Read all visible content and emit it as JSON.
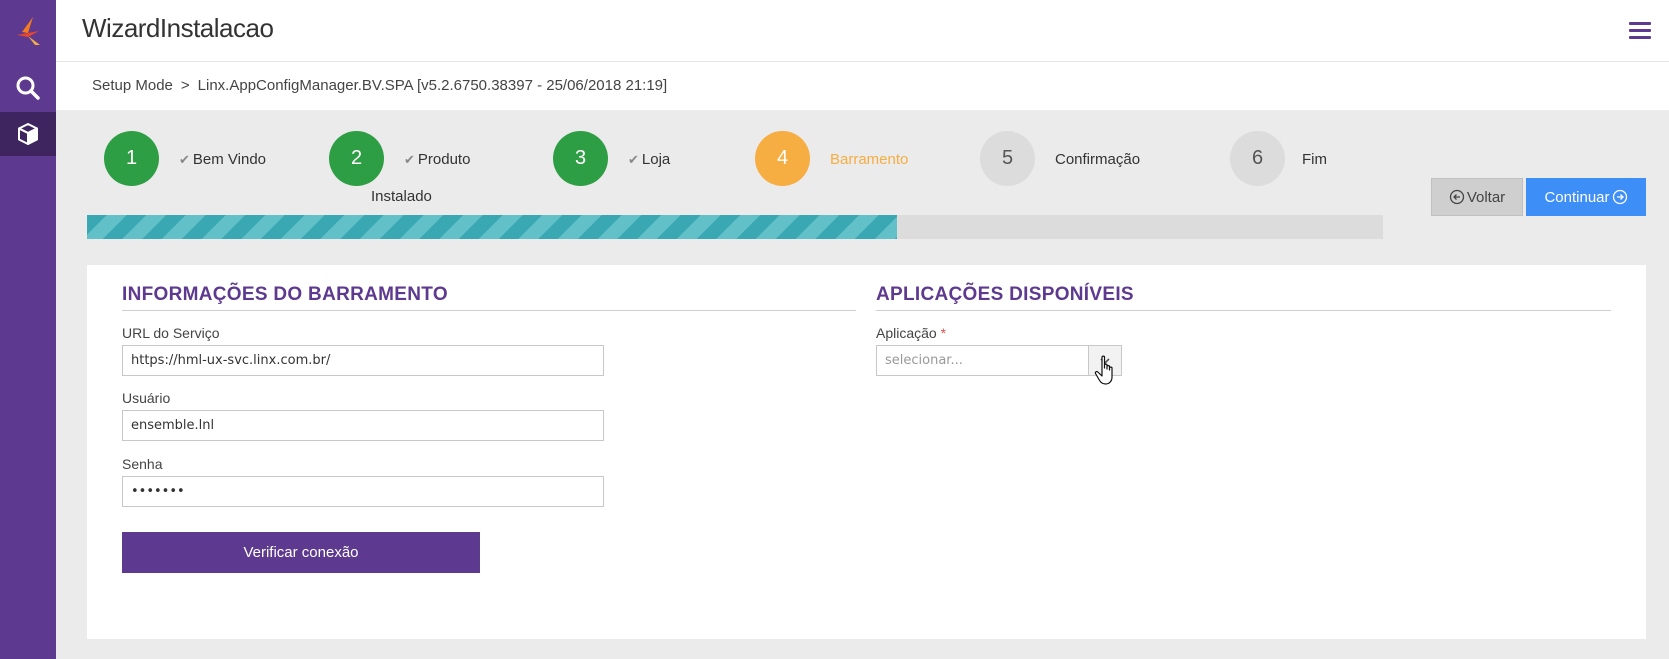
{
  "app": {
    "title": "WizardInstalacao"
  },
  "breadcrumb": {
    "items": [
      "Setup Mode",
      "Linx.AppConfigManager.BV.SPA [v5.2.6750.38397 - 25/06/2018 21:19]"
    ],
    "separator": ">"
  },
  "wizard": {
    "steps": [
      {
        "number": "1",
        "label": "Bem Vindo",
        "label_line2": "",
        "status": "done"
      },
      {
        "number": "2",
        "label": "Produto",
        "label_line2": "Instalado",
        "status": "done"
      },
      {
        "number": "3",
        "label": "Loja",
        "label_line2": "",
        "status": "done"
      },
      {
        "number": "4",
        "label": "Barramento",
        "label_line2": "",
        "status": "current"
      },
      {
        "number": "5",
        "label": "Confirmação",
        "label_line2": "",
        "status": "pending"
      },
      {
        "number": "6",
        "label": "Fim",
        "label_line2": "",
        "status": "pending"
      }
    ],
    "progress_fraction": 0.625,
    "back_label": "Voltar",
    "next_label": "Continuar"
  },
  "bus_section": {
    "title": "INFORMAÇÕES DO BARRAMENTO",
    "url_label": "URL do Serviço",
    "url_value": "https://hml-ux-svc.linx.com.br/",
    "user_label": "Usuário",
    "user_value": "ensemble.lnl",
    "password_label": "Senha",
    "password_value": "•••••••",
    "verify_button": "Verificar conexão"
  },
  "apps_section": {
    "title": "APLICAÇÕES DISPONÍVEIS",
    "app_label": "Aplicação",
    "required_mark": "*",
    "app_placeholder": "selecionar..."
  },
  "colors": {
    "sidebar": "#5d3a8f",
    "accent_purple": "#5d3a8f",
    "step_done": "#2e9e45",
    "step_current": "#f6ad41",
    "step_pending": "#dcdcdc",
    "primary_button": "#3e8ef7",
    "progress": "#3aa8b3"
  },
  "icons": {
    "sidebar": [
      "linx-logo-icon",
      "search-icon",
      "package-box-icon"
    ],
    "menu": "hamburger-menu-icon",
    "check": "check-icon",
    "back": "arrow-left-circle-icon",
    "next": "arrow-right-circle-icon",
    "dropdown": "chevron-down-icon"
  }
}
